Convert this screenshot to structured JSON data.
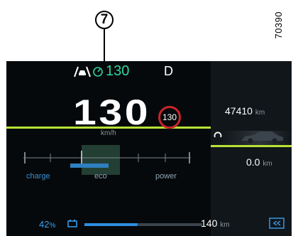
{
  "annotation": {
    "callout_number": "7",
    "reference_code": "70390"
  },
  "cluster": {
    "acc_set_speed": "130",
    "gear": "D",
    "speed": {
      "value": "130",
      "unit": "km/h"
    },
    "speed_limit": "130",
    "odometer": {
      "value": "47410",
      "unit": "km"
    },
    "trip": {
      "value": "0.0",
      "unit": "km"
    },
    "power_gauge": {
      "labels": [
        "charge",
        "eco",
        "power"
      ],
      "needle_fraction": 0.5
    },
    "battery": {
      "percent": "42",
      "percent_sign": "%"
    },
    "range": {
      "value": "140",
      "unit": "km",
      "bar_fill_fraction": 0.45
    },
    "colors": {
      "acc_green": "#31d39c",
      "line_green": "#b7e337",
      "charge_blue": "#3a8fd4",
      "limit_red": "#c9242b",
      "background": "#06090b"
    },
    "icons": [
      "lane-assist-icon",
      "acc-speedometer-icon",
      "ready-icon",
      "car-icon",
      "battery-icon",
      "regen-mode-icon"
    ]
  }
}
